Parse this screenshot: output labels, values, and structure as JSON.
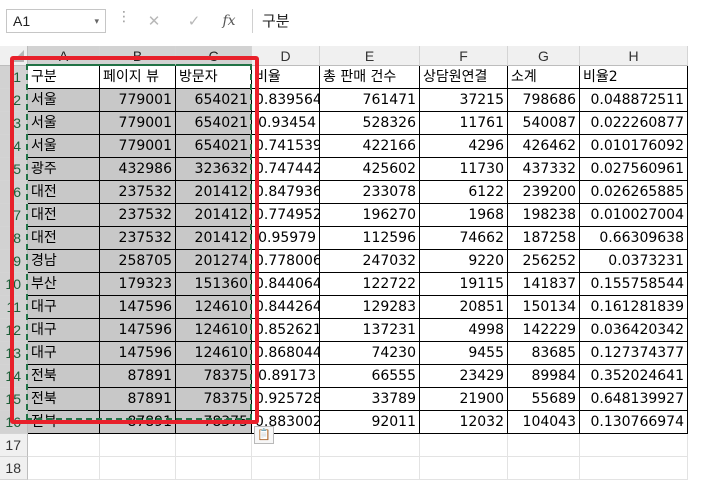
{
  "formula_bar": {
    "name_box": "A1",
    "name_box_dropdown_icon": "▾",
    "separator": "⋮",
    "cancel_icon": "✕",
    "enter_icon": "✓",
    "fx_label": "fx",
    "formula_value": "구분"
  },
  "columns": [
    "A",
    "B",
    "C",
    "D",
    "E",
    "F",
    "G",
    "H"
  ],
  "rows": [
    {
      "num": "1",
      "cells": [
        "구분",
        "페이지 뷰",
        "방문자",
        "비율",
        "총 판매 건수",
        "상담원연결",
        "소계",
        "비율2"
      ]
    },
    {
      "num": "2",
      "cells": [
        "서울",
        "779001",
        "654021",
        "0.839564",
        "761471",
        "37215",
        "798686",
        "0.048872511"
      ]
    },
    {
      "num": "3",
      "cells": [
        "서울",
        "779001",
        "654021",
        "0.93454",
        "528326",
        "11761",
        "540087",
        "0.022260877"
      ]
    },
    {
      "num": "4",
      "cells": [
        "서울",
        "779001",
        "654021",
        "0.741539",
        "422166",
        "4296",
        "426462",
        "0.010176092"
      ]
    },
    {
      "num": "5",
      "cells": [
        "광주",
        "432986",
        "323632",
        "0.747442",
        "425602",
        "11730",
        "437332",
        "0.027560961"
      ]
    },
    {
      "num": "6",
      "cells": [
        "대전",
        "237532",
        "201412",
        "0.847936",
        "233078",
        "6122",
        "239200",
        "0.026265885"
      ]
    },
    {
      "num": "7",
      "cells": [
        "대전",
        "237532",
        "201412",
        "0.774952",
        "196270",
        "1968",
        "198238",
        "0.010027004"
      ]
    },
    {
      "num": "8",
      "cells": [
        "대전",
        "237532",
        "201412",
        "0.95979",
        "112596",
        "74662",
        "187258",
        "0.66309638"
      ]
    },
    {
      "num": "9",
      "cells": [
        "경남",
        "258705",
        "201274",
        "0.778006",
        "247032",
        "9220",
        "256252",
        "0.0373231"
      ]
    },
    {
      "num": "10",
      "cells": [
        "부산",
        "179323",
        "151360",
        "0.844064",
        "122722",
        "19115",
        "141837",
        "0.155758544"
      ]
    },
    {
      "num": "11",
      "cells": [
        "대구",
        "147596",
        "124610",
        "0.844264",
        "129283",
        "20851",
        "150134",
        "0.161281839"
      ]
    },
    {
      "num": "12",
      "cells": [
        "대구",
        "147596",
        "124610",
        "0.852621",
        "137231",
        "4998",
        "142229",
        "0.036420342"
      ]
    },
    {
      "num": "13",
      "cells": [
        "대구",
        "147596",
        "124610",
        "0.868044",
        "74230",
        "9455",
        "83685",
        "0.127374377"
      ]
    },
    {
      "num": "14",
      "cells": [
        "전북",
        "87891",
        "78375",
        "0.89173",
        "66555",
        "23429",
        "89984",
        "0.352024641"
      ]
    },
    {
      "num": "15",
      "cells": [
        "전북",
        "87891",
        "78375",
        "0.925728",
        "33789",
        "21900",
        "55689",
        "0.648139927"
      ]
    },
    {
      "num": "16",
      "cells": [
        "전북",
        "87891",
        "78375",
        "0.883002",
        "92011",
        "12032",
        "104043",
        "0.130766974"
      ]
    },
    {
      "num": "17",
      "cells": [
        "",
        "",
        "",
        "",
        "",
        "",
        "",
        ""
      ]
    },
    {
      "num": "18",
      "cells": [
        "",
        "",
        "",
        "",
        "",
        "",
        "",
        ""
      ]
    }
  ],
  "paste_options_icon": "📋"
}
